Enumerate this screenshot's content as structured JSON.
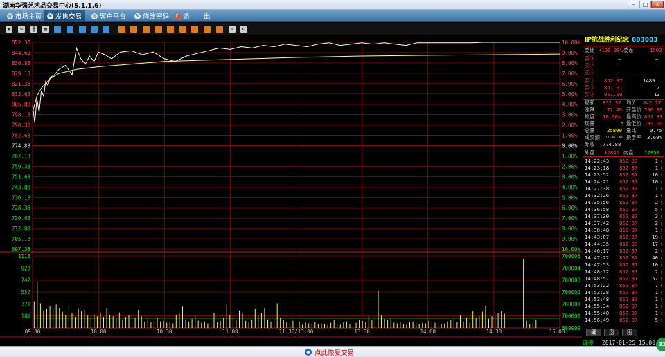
{
  "window": {
    "title": "湖南华强艺术品交易中心(5.1.1.6)",
    "min": "–",
    "max": "□",
    "close": "✕"
  },
  "menu": [
    {
      "label": "市场主页",
      "icon": "globe-icon",
      "active": false,
      "x": 6
    },
    {
      "label": "发售交易",
      "icon": "yen-icon",
      "active": true,
      "x": 64
    },
    {
      "label": "客户平台",
      "icon": "globe-icon",
      "active": false,
      "x": 128
    },
    {
      "label": "修改密码",
      "icon": "key-icon",
      "active": false,
      "x": 190
    },
    {
      "label": "退",
      "icon": "power-icon",
      "active": false,
      "x": 248
    },
    {
      "label": "出",
      "icon": "",
      "active": false,
      "x": 290
    }
  ],
  "toolbar": {
    "buttons": [
      {
        "name": "bar-chart-icon",
        "k": "c",
        "x": 8
      },
      {
        "name": "line-chart-icon",
        "k": "c",
        "x": 26
      },
      {
        "name": "candle-icon",
        "k": "c",
        "x": 44
      },
      {
        "name": "calculator-icon",
        "k": "c",
        "x": 61
      },
      {
        "name": "tool-icon-1",
        "k": "a",
        "x": 78
      },
      {
        "name": "tool-icon-2",
        "k": "a",
        "x": 96
      },
      {
        "name": "tool-icon-3",
        "k": "a",
        "x": 114
      },
      {
        "name": "tool-icon-4",
        "k": "a",
        "x": 131
      },
      {
        "name": "tool-icon-5",
        "k": "a",
        "x": 148
      },
      {
        "name": "tool-icon-6",
        "k": "b",
        "x": 171
      },
      {
        "name": "tool-icon-7",
        "k": "b",
        "x": 188
      },
      {
        "name": "tool-icon-8",
        "k": "b",
        "x": 206
      },
      {
        "name": "tool-icon-9",
        "k": "b",
        "x": 224
      },
      {
        "name": "tool-icon-10",
        "k": "b",
        "x": 241
      },
      {
        "name": "tool-icon-11",
        "k": "b",
        "x": 259
      },
      {
        "name": "tool-icon-12",
        "k": "b",
        "x": 276
      },
      {
        "name": "tool-icon-13",
        "k": "b",
        "x": 294
      },
      {
        "name": "tool-icon-14",
        "k": "b",
        "x": 312
      },
      {
        "name": "pencil-icon",
        "k": "c",
        "x": 330
      },
      {
        "name": "gear-icon",
        "k": "c",
        "x": 347
      }
    ]
  },
  "chart_data": {
    "type": "line",
    "price_axis": {
      "labels": [
        "852.38",
        "844.63",
        "836.88",
        "829.13",
        "821.38",
        "813.63",
        "805.88",
        "798.13",
        "790.38",
        "782.63",
        "774.88",
        "767.13",
        "759.38",
        "751.63",
        "743.88",
        "736.13",
        "728.38",
        "720.63",
        "712.88",
        "705.13",
        "697.38"
      ],
      "base_index": 10
    },
    "pct_axis": {
      "labels": [
        "10.00%",
        "9.00%",
        "8.00%",
        "7.00%",
        "6.00%",
        "5.00%",
        "4.00%",
        "3.00%",
        "2.00%",
        "1.00%",
        "0.00%",
        "1.00%",
        "2.00%",
        "3.00%",
        "4.00%",
        "5.00%",
        "6.00%",
        "7.00%",
        "8.00%",
        "9.00%",
        "10.00%"
      ]
    },
    "ylim": [
      697.38,
      852.38
    ],
    "prev_close": 774.88,
    "time_labels": [
      "09:30",
      "10:00",
      "10:30",
      "11:00",
      "11:30/13:00",
      "13:30",
      "14:00",
      "14:30",
      "15:00"
    ],
    "price_series": {
      "t": [
        0,
        1,
        2,
        3,
        4,
        5,
        6,
        7,
        8,
        10,
        12,
        15,
        18,
        20,
        22,
        24,
        26,
        28,
        30,
        33,
        36,
        40,
        45,
        50,
        55,
        60,
        65,
        70,
        75,
        80,
        85,
        90,
        95,
        100,
        105,
        110,
        115,
        120,
        125,
        130,
        135,
        140,
        145,
        150,
        155,
        160,
        165,
        170,
        175,
        180,
        185,
        190,
        195,
        200,
        205,
        210,
        215,
        220,
        225,
        230,
        235,
        240
      ],
      "v": [
        805,
        792,
        810,
        800,
        816,
        812,
        823,
        820,
        826,
        828,
        832,
        835,
        828,
        848,
        840,
        836,
        842,
        838,
        845,
        843,
        840,
        845,
        846,
        843,
        845,
        840,
        838,
        842,
        844,
        846,
        848,
        847,
        849,
        848,
        850,
        849,
        851,
        850,
        849,
        851,
        852,
        850,
        851,
        852,
        851,
        852,
        851,
        850,
        852,
        852,
        852,
        852,
        852,
        852,
        852.37,
        852.37,
        852.37,
        852.37,
        852.37,
        852.37,
        852.37,
        852.37
      ]
    },
    "avg_series": {
      "t": [
        0,
        2,
        4,
        8,
        12,
        20,
        30,
        45,
        60,
        80,
        100,
        120,
        150,
        180,
        210,
        240
      ],
      "v": [
        800,
        812,
        818,
        825,
        829,
        832,
        834,
        836,
        838,
        839,
        840,
        841,
        842,
        842.6,
        843,
        843.5
      ]
    },
    "volume_axis": {
      "labels": [
        "1113",
        "928",
        "742",
        "557",
        "371",
        "186"
      ],
      "ylim": [
        0,
        1113
      ]
    },
    "volume_right_axis": {
      "labels": [
        "700005",
        "700004",
        "700003",
        "700002",
        "700001",
        "700000",
        "699999"
      ]
    },
    "volume": [
      410,
      720,
      380,
      270,
      300,
      340,
      290,
      360,
      310,
      250,
      200,
      330,
      230,
      170,
      300,
      260,
      280,
      190,
      150,
      210,
      180,
      240,
      170,
      310,
      200,
      180,
      150,
      240,
      130,
      170,
      200,
      120,
      160,
      280,
      180,
      100,
      150,
      90,
      120,
      160,
      100,
      110,
      80,
      90,
      70,
      200,
      230,
      330,
      120,
      100,
      140,
      190,
      110,
      80,
      100,
      70,
      140,
      230,
      90,
      110,
      160,
      360,
      200,
      180,
      120,
      270,
      220,
      110,
      90,
      130,
      300,
      190,
      230,
      310,
      130,
      100,
      140,
      380,
      160,
      120,
      90,
      70,
      110,
      60,
      100,
      50,
      80,
      70,
      60,
      90,
      60,
      70,
      60,
      50,
      80,
      120,
      60,
      50,
      90,
      100,
      60,
      40,
      80,
      120,
      110,
      90,
      170,
      120,
      180,
      580,
      190,
      140,
      130,
      160,
      80,
      70,
      90,
      60,
      50,
      90,
      100,
      70,
      60,
      80,
      70,
      110,
      90,
      80,
      50,
      60,
      70,
      100,
      120,
      160,
      90,
      190,
      100,
      150,
      80,
      260,
      150,
      180,
      250,
      340,
      140,
      180,
      200,
      230,
      260,
      220,
      0,
      0,
      0,
      0,
      0,
      1060,
      110,
      60,
      90,
      130,
      0,
      0,
      0,
      0,
      0,
      0,
      0
    ],
    "colors": {
      "price": "#ffffff",
      "avg": "#ffff90",
      "grid": "#8c0a0a",
      "axis_up": "#ff4d4d",
      "axis_down": "#22dd22",
      "volume": "#f0f060"
    }
  },
  "quote": {
    "name": "IP抗战胜利纪念",
    "code": "603003",
    "weibi_label": "委比",
    "weibi": "+100.00%",
    "weicha_label": "委差",
    "weicha": "1502",
    "sell": [
      {
        "label": "卖③",
        "price": "—",
        "vol": "—"
      },
      {
        "label": "卖②",
        "price": "—",
        "vol": "—"
      },
      {
        "label": "卖①",
        "price": "—",
        "vol": "—"
      }
    ],
    "buy": [
      {
        "label": "买①",
        "price": "852.37",
        "vol": "1489"
      },
      {
        "label": "买②",
        "price": "851.01",
        "vol": "2"
      },
      {
        "label": "买③",
        "price": "851.00",
        "vol": "13"
      }
    ],
    "latest_label": "最新",
    "latest": "852.37",
    "avg_label": "均价",
    "avg": "842.27",
    "change_label": "涨跌",
    "change": "77.49",
    "open_label": "开盘价",
    "open": "790.00",
    "range_label": "幅度",
    "range": "10.00%",
    "high_label": "最高价",
    "high": "852.37",
    "cur_label": "现量",
    "cur": "5",
    "low_label": "最低价",
    "low": "785.00",
    "total_label": "总量",
    "total": "25800",
    "ratio_label": "量比",
    "ratio": "0.75",
    "amount_label": "成交额",
    "amount": "21733617.00",
    "turnover_label": "换手率",
    "turnover": "3.69%",
    "prev_label": "昨收",
    "prev": "774.88",
    "outer_label": "外盘",
    "outer": "12841",
    "inner_label": "内盘",
    "inner": "12959"
  },
  "ticks": [
    {
      "time": "14:22:43",
      "price": "852.37",
      "vol": "1"
    },
    {
      "time": "14:23:18",
      "price": "852.37",
      "vol": "1"
    },
    {
      "time": "14:23:52",
      "price": "852.37",
      "vol": "10"
    },
    {
      "time": "14:24:21",
      "price": "852.37",
      "vol": "10"
    },
    {
      "time": "14:27:38",
      "price": "852.37",
      "vol": "1"
    },
    {
      "time": "14:32:26",
      "price": "852.37",
      "vol": "1"
    },
    {
      "time": "14:35:56",
      "price": "852.37",
      "vol": "2"
    },
    {
      "time": "14:36:58",
      "price": "852.37",
      "vol": "5"
    },
    {
      "time": "14:37:30",
      "price": "852.37",
      "vol": "3"
    },
    {
      "time": "14:37:42",
      "price": "852.37",
      "vol": "2"
    },
    {
      "time": "14:38:48",
      "price": "852.37",
      "vol": "1"
    },
    {
      "time": "14:43:07",
      "price": "852.37",
      "vol": "19"
    },
    {
      "time": "14:44:35",
      "price": "852.37",
      "vol": "17"
    },
    {
      "time": "14:46:17",
      "price": "852.37",
      "vol": "2"
    },
    {
      "time": "14:47:22",
      "price": "852.37",
      "vol": "40"
    },
    {
      "time": "14:47:53",
      "price": "852.37",
      "vol": "10"
    },
    {
      "time": "14:48:12",
      "price": "852.37",
      "vol": "2"
    },
    {
      "time": "14:48:57",
      "price": "852.37",
      "vol": "57"
    },
    {
      "time": "14:53:22",
      "price": "852.37",
      "vol": "7"
    },
    {
      "time": "14:53:28",
      "price": "852.37",
      "vol": "1"
    },
    {
      "time": "14:53:48",
      "price": "852.37",
      "vol": "1"
    },
    {
      "time": "14:55:34",
      "price": "852.37",
      "vol": "1"
    },
    {
      "time": "14:55:40",
      "price": "852.37",
      "vol": "1"
    },
    {
      "time": "14:56:49",
      "price": "852.37",
      "vol": "5"
    }
  ],
  "side_tabs": [
    "细",
    "盘",
    "图"
  ],
  "status": {
    "conn": "连接",
    "datetime": "2017-01-25 15:00"
  },
  "bottom": {
    "restore": "点此恢复交易"
  },
  "badge": "32"
}
